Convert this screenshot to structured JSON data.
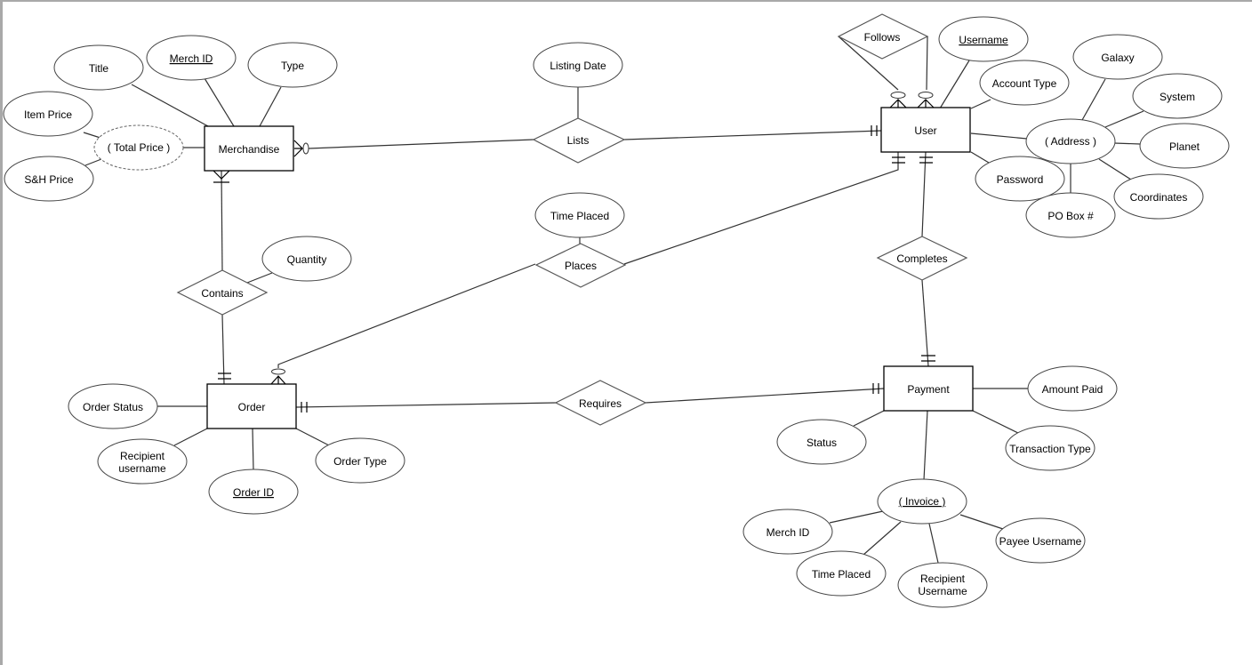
{
  "diagram": {
    "type": "entity-relationship",
    "entities": [
      {
        "id": "merchandise",
        "label": "Merchandise"
      },
      {
        "id": "user",
        "label": "User"
      },
      {
        "id": "order",
        "label": "Order"
      },
      {
        "id": "payment",
        "label": "Payment"
      }
    ],
    "relationships": [
      {
        "id": "lists",
        "label": "Lists"
      },
      {
        "id": "follows",
        "label": "Follows"
      },
      {
        "id": "contains",
        "label": "Contains"
      },
      {
        "id": "places",
        "label": "Places"
      },
      {
        "id": "completes",
        "label": "Completes"
      },
      {
        "id": "requires",
        "label": "Requires"
      }
    ],
    "attributes": [
      {
        "id": "title",
        "label": "Title",
        "owner": "merchandise"
      },
      {
        "id": "merch_id",
        "label": "Merch ID",
        "owner": "merchandise",
        "key": true
      },
      {
        "id": "type",
        "label": "Type",
        "owner": "merchandise"
      },
      {
        "id": "total_price",
        "label": "( Total Price )",
        "owner": "merchandise",
        "derived": true
      },
      {
        "id": "item_price",
        "label": "Item Price",
        "owner": "total_price"
      },
      {
        "id": "sh_price",
        "label": "S&H Price",
        "owner": "total_price"
      },
      {
        "id": "listing_date",
        "label": "Listing Date",
        "owner": "lists"
      },
      {
        "id": "username",
        "label": "Username",
        "owner": "user",
        "key": true
      },
      {
        "id": "account_type",
        "label": "Account Type",
        "owner": "user"
      },
      {
        "id": "password",
        "label": "Password",
        "owner": "user"
      },
      {
        "id": "address",
        "label": "( Address )",
        "owner": "user",
        "composite": true
      },
      {
        "id": "galaxy",
        "label": "Galaxy",
        "owner": "address"
      },
      {
        "id": "system",
        "label": "System",
        "owner": "address"
      },
      {
        "id": "planet",
        "label": "Planet",
        "owner": "address"
      },
      {
        "id": "coordinates",
        "label": "Coordinates",
        "owner": "address"
      },
      {
        "id": "po_box",
        "label": "PO Box #",
        "owner": "address"
      },
      {
        "id": "quantity",
        "label": "Quantity",
        "owner": "contains"
      },
      {
        "id": "time_placed_rel",
        "label": "Time Placed",
        "owner": "places"
      },
      {
        "id": "order_status",
        "label": "Order Status",
        "owner": "order"
      },
      {
        "id": "recipient_username_order",
        "label": "Recipient username",
        "lines": [
          "Recipient",
          "username"
        ],
        "owner": "order"
      },
      {
        "id": "order_id",
        "label": "Order ID",
        "owner": "order",
        "key": true
      },
      {
        "id": "order_type",
        "label": "Order Type",
        "owner": "order"
      },
      {
        "id": "amount_paid",
        "label": "Amount Paid",
        "owner": "payment"
      },
      {
        "id": "status",
        "label": "Status",
        "owner": "payment"
      },
      {
        "id": "transaction_type",
        "label": "Transaction Type",
        "owner": "payment"
      },
      {
        "id": "invoice",
        "label": "( Invoice )",
        "owner": "payment",
        "key": true,
        "composite": true
      },
      {
        "id": "merch_id_inv",
        "label": "Merch ID",
        "owner": "invoice"
      },
      {
        "id": "time_placed_inv",
        "label": "Time Placed",
        "owner": "invoice"
      },
      {
        "id": "recipient_username_inv",
        "label": "Recipient Username",
        "lines": [
          "Recipient",
          "Username"
        ],
        "owner": "invoice"
      },
      {
        "id": "payee_username",
        "label": "Payee Username",
        "owner": "invoice"
      }
    ],
    "connections": [
      {
        "from": "merchandise",
        "to": "lists",
        "from_cardinality": "zero-or-many"
      },
      {
        "from": "lists",
        "to": "user",
        "to_cardinality": "exactly-one"
      },
      {
        "from": "user",
        "to": "follows",
        "from_cardinality": "zero-or-many"
      },
      {
        "from": "user",
        "to": "follows",
        "from_cardinality": "zero-or-many"
      },
      {
        "from": "merchandise",
        "to": "contains",
        "from_cardinality": "one-or-many"
      },
      {
        "from": "contains",
        "to": "order",
        "to_cardinality": "exactly-one"
      },
      {
        "from": "order",
        "to": "places",
        "from_cardinality": "zero-or-many"
      },
      {
        "from": "places",
        "to": "user",
        "to_cardinality": "exactly-one"
      },
      {
        "from": "user",
        "to": "completes",
        "from_cardinality": "exactly-one"
      },
      {
        "from": "completes",
        "to": "payment",
        "to_cardinality": "exactly-one"
      },
      {
        "from": "order",
        "to": "requires",
        "from_cardinality": "exactly-one"
      },
      {
        "from": "requires",
        "to": "payment",
        "to_cardinality": "exactly-one"
      }
    ]
  }
}
